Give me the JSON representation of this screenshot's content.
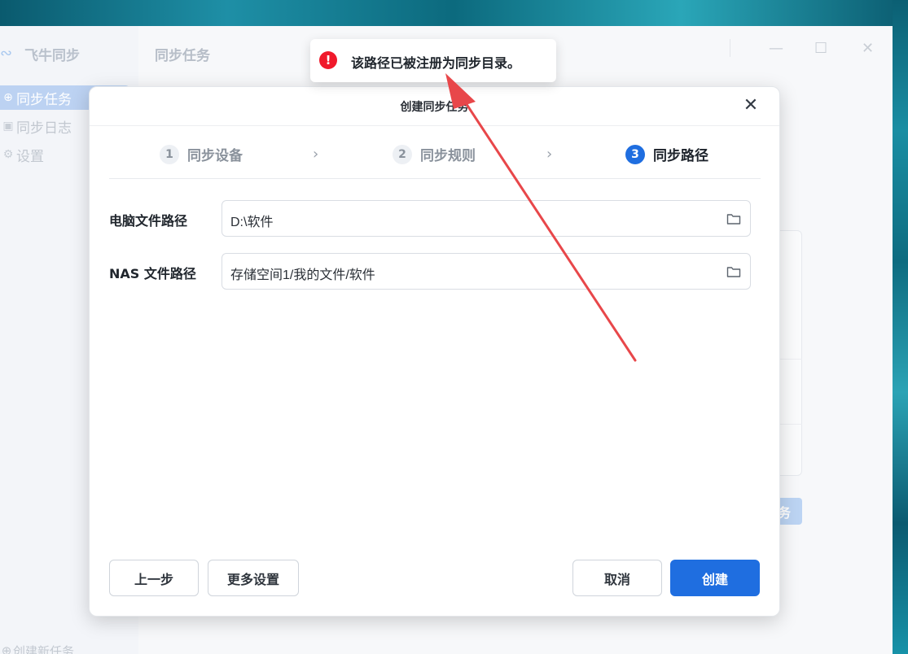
{
  "app": {
    "name": "飞牛同步",
    "title": "同步任务",
    "nav": [
      {
        "label": "同步任务",
        "icon": "sync-circle-icon"
      },
      {
        "label": "同步日志",
        "icon": "log-icon"
      },
      {
        "label": "设置",
        "icon": "gear-icon"
      }
    ],
    "bottom_action": "创建新任务",
    "bg_button_partial": "务"
  },
  "window_controls": {
    "minimize": "—",
    "maximize": "☐",
    "close": "✕"
  },
  "modal": {
    "title": "创建同步任务",
    "close_glyph": "✕",
    "steps": [
      {
        "number": "1",
        "label": "同步设备"
      },
      {
        "number": "2",
        "label": "同步规则"
      },
      {
        "number": "3",
        "label": "同步路径"
      }
    ],
    "chevron": "›",
    "fields": [
      {
        "label": "电脑文件路径",
        "value": "D:\\软件"
      },
      {
        "label": "NAS 文件路径",
        "value": "存储空间1/我的文件/软件"
      }
    ],
    "buttons": {
      "prev": "上一步",
      "more": "更多设置",
      "cancel": "取消",
      "create": "创建"
    }
  },
  "toast": {
    "icon": "!",
    "message": "该路径已被注册为同步目录。"
  },
  "colors": {
    "accent": "#1f6ee0",
    "error": "#f0192b",
    "annotation_arrow": "#e8474a"
  }
}
